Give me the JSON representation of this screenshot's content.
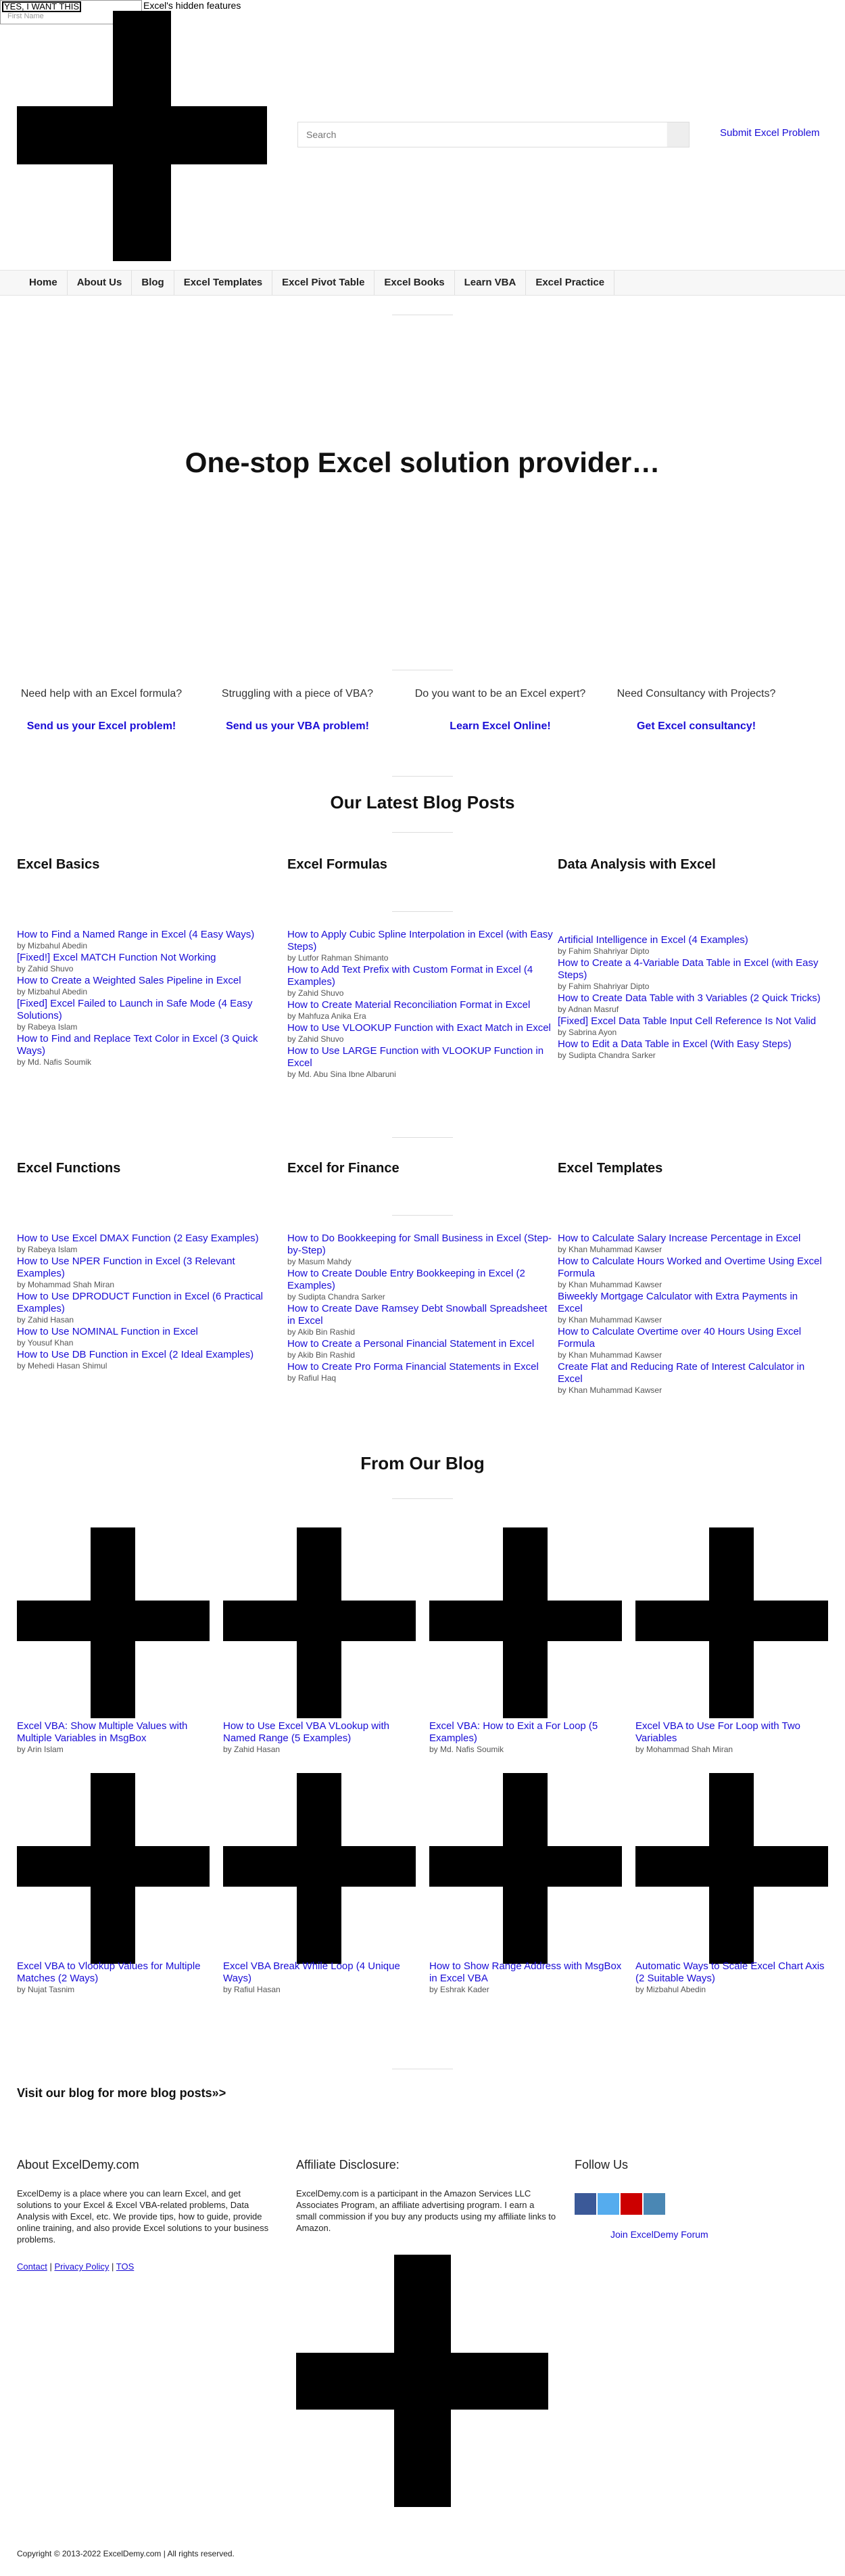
{
  "topbar": {
    "yes_button": "YES, I WANT THIS",
    "email_placeholder": "First Name",
    "headline": "Excel's hidden features"
  },
  "header": {
    "search_placeholder": "Search",
    "submit_link": "Submit Excel Problem"
  },
  "nav": {
    "items": [
      "Home",
      "About Us",
      "Blog",
      "Excel Templates",
      "Excel Pivot Table",
      "Excel Books",
      "Learn VBA",
      "Excel Practice"
    ]
  },
  "hero": {
    "title": "One-stop Excel solution provider…"
  },
  "cta": [
    {
      "question": "Need help with an Excel formula?",
      "link": "Send us your Excel problem!"
    },
    {
      "question": "Struggling with a piece of VBA?",
      "link": "Send us your VBA problem!"
    },
    {
      "question": "Do you want to be an Excel expert?",
      "link": "Learn Excel Online!"
    },
    {
      "question": "Need Consultancy with Projects?",
      "link": "Get Excel consultancy!"
    }
  ],
  "latest": {
    "title": "Our Latest Blog Posts",
    "categories": [
      {
        "name": "Excel Basics",
        "posts": [
          {
            "title": "How to Find a Named Range in Excel (4 Easy Ways)",
            "author": "by Mizbahul Abedin"
          },
          {
            "title": "[Fixed!] Excel MATCH Function Not Working",
            "author": "by Zahid Shuvo"
          },
          {
            "title": "How to Create a Weighted Sales Pipeline in Excel",
            "author": "by Mizbahul Abedin"
          },
          {
            "title": "[Fixed] Excel Failed to Launch in Safe Mode (4 Easy Solutions)",
            "author": "by Rabeya Islam"
          },
          {
            "title": "How to Find and Replace Text Color in Excel (3 Quick Ways)",
            "author": "by Md. Nafis Soumik"
          }
        ]
      },
      {
        "name": "Excel Formulas",
        "posts": [
          {
            "title": "How to Apply Cubic Spline Interpolation in Excel (with Easy Steps)",
            "author": "by Lutfor Rahman Shimanto"
          },
          {
            "title": "How to Add Text Prefix with Custom Format in Excel (4 Examples)",
            "author": "by Zahid Shuvo"
          },
          {
            "title": "How to Create Material Reconciliation Format in Excel",
            "author": "by Mahfuza Anika Era"
          },
          {
            "title": "How to Use VLOOKUP Function with Exact Match in Excel",
            "author": "by Zahid Shuvo"
          },
          {
            "title": "How to Use LARGE Function with VLOOKUP Function in Excel",
            "author": "by Md. Abu Sina Ibne Albaruni"
          }
        ]
      },
      {
        "name": "Data Analysis with Excel",
        "posts": [
          {
            "title": "Artificial Intelligence in Excel (4 Examples)",
            "author": "by Fahim Shahriyar Dipto"
          },
          {
            "title": "How to Create a 4-Variable Data Table in Excel (with Easy Steps)",
            "author": "by Fahim Shahriyar Dipto"
          },
          {
            "title": "How to Create Data Table with 3 Variables (2 Quick Tricks)",
            "author": "by Adnan Masruf"
          },
          {
            "title": "[Fixed] Excel Data Table Input Cell Reference Is Not Valid",
            "author": "by Sabrina Ayon"
          },
          {
            "title": "How to Edit a Data Table in Excel (With Easy Steps)",
            "author": "by Sudipta Chandra Sarker"
          }
        ]
      },
      {
        "name": "Excel Functions",
        "posts": [
          {
            "title": "How to Use Excel DMAX Function (2 Easy Examples)",
            "author": "by Rabeya Islam"
          },
          {
            "title": "How to Use NPER Function in Excel (3 Relevant Examples)",
            "author": "by Mohammad Shah Miran"
          },
          {
            "title": "How to Use DPRODUCT Function in Excel (6 Practical Examples)",
            "author": "by Zahid Hasan"
          },
          {
            "title": "How to Use NOMINAL Function in Excel",
            "author": "by Yousuf Khan"
          },
          {
            "title": "How to Use DB Function in Excel (2 Ideal Examples)",
            "author": "by Mehedi Hasan Shimul"
          }
        ]
      },
      {
        "name": "Excel for Finance",
        "posts": [
          {
            "title": "How to Do Bookkeeping for Small Business in Excel (Step-by-Step)",
            "author": "by Masum Mahdy"
          },
          {
            "title": "How to Create Double Entry Bookkeeping in Excel (2 Examples)",
            "author": "by Sudipta Chandra Sarker"
          },
          {
            "title": "How to Create Dave Ramsey Debt Snowball Spreadsheet in Excel",
            "author": "by Akib Bin Rashid"
          },
          {
            "title": "How to Create a Personal Financial Statement in Excel",
            "author": "by Akib Bin Rashid"
          },
          {
            "title": "How to Create Pro Forma Financial Statements in Excel",
            "author": "by Rafiul Haq"
          }
        ]
      },
      {
        "name": "Excel Templates",
        "posts": [
          {
            "title": "How to Calculate Salary Increase Percentage in Excel",
            "author": "by Khan Muhammad Kawser"
          },
          {
            "title": "How to Calculate Hours Worked and Overtime Using Excel Formula",
            "author": "by Khan Muhammad Kawser"
          },
          {
            "title": "Biweekly Mortgage Calculator with Extra Payments in Excel",
            "author": "by Khan Muhammad Kawser"
          },
          {
            "title": "How to Calculate Overtime over 40 Hours Using Excel Formula",
            "author": "by Khan Muhammad Kawser"
          },
          {
            "title": "Create Flat and Reducing Rate of Interest Calculator in Excel",
            "author": "by Khan Muhammad Kawser"
          }
        ]
      }
    ]
  },
  "from_blog": {
    "title": "From Our Blog",
    "cards": [
      {
        "title": "Excel VBA: Show Multiple Values with Multiple Variables in MsgBox",
        "author": "by Arin Islam"
      },
      {
        "title": "How to Use Excel VBA VLookup with Named Range (5 Examples)",
        "author": "by Zahid Hasan"
      },
      {
        "title": "Excel VBA: How to Exit a For Loop (5 Examples)",
        "author": "by Md. Nafis Soumik"
      },
      {
        "title": "Excel VBA to Use For Loop with Two Variables",
        "author": "by Mohammad Shah Miran"
      },
      {
        "title": "Excel VBA to Vlookup Values for Multiple Matches (2 Ways)",
        "author": "by Nujat Tasnim"
      },
      {
        "title": "Excel VBA Break While Loop (4 Unique Ways)",
        "author": "by Rafiul Hasan"
      },
      {
        "title": "How to Show Range Address with MsgBox in Excel VBA",
        "author": "by Eshrak Kader"
      },
      {
        "title": "Automatic Ways to Scale Excel Chart Axis (2 Suitable Ways)",
        "author": "by Mizbahul Abedin"
      }
    ]
  },
  "visit": {
    "text": "Visit our blog for more blog posts»>"
  },
  "footer": {
    "about_title": "About ExcelDemy.com",
    "about_text": "ExcelDemy is a place where you can learn Excel, and get solutions to your Excel & Excel VBA-related problems, Data Analysis with Excel, etc. We provide tips, how to guide, provide online training, and also provide Excel solutions to your business problems.",
    "links": [
      "Contact",
      "Privacy Policy",
      "TOS"
    ],
    "affiliate_title": "Affiliate Disclosure:",
    "affiliate_text": "ExcelDemy.com is a participant in the Amazon Services LLC Associates Program, an affiliate advertising program. I earn a small commission if you buy any products using my affiliate links to Amazon.",
    "follow_title": "Follow Us",
    "social_colors": [
      "#3b5998",
      "#55acee",
      "#cc0000",
      "#4a87b4"
    ],
    "forum_link": "Join ExcelDemy Forum",
    "copyright": "Copyright © 2013-2022 ExcelDemy.com | All rights reserved."
  }
}
